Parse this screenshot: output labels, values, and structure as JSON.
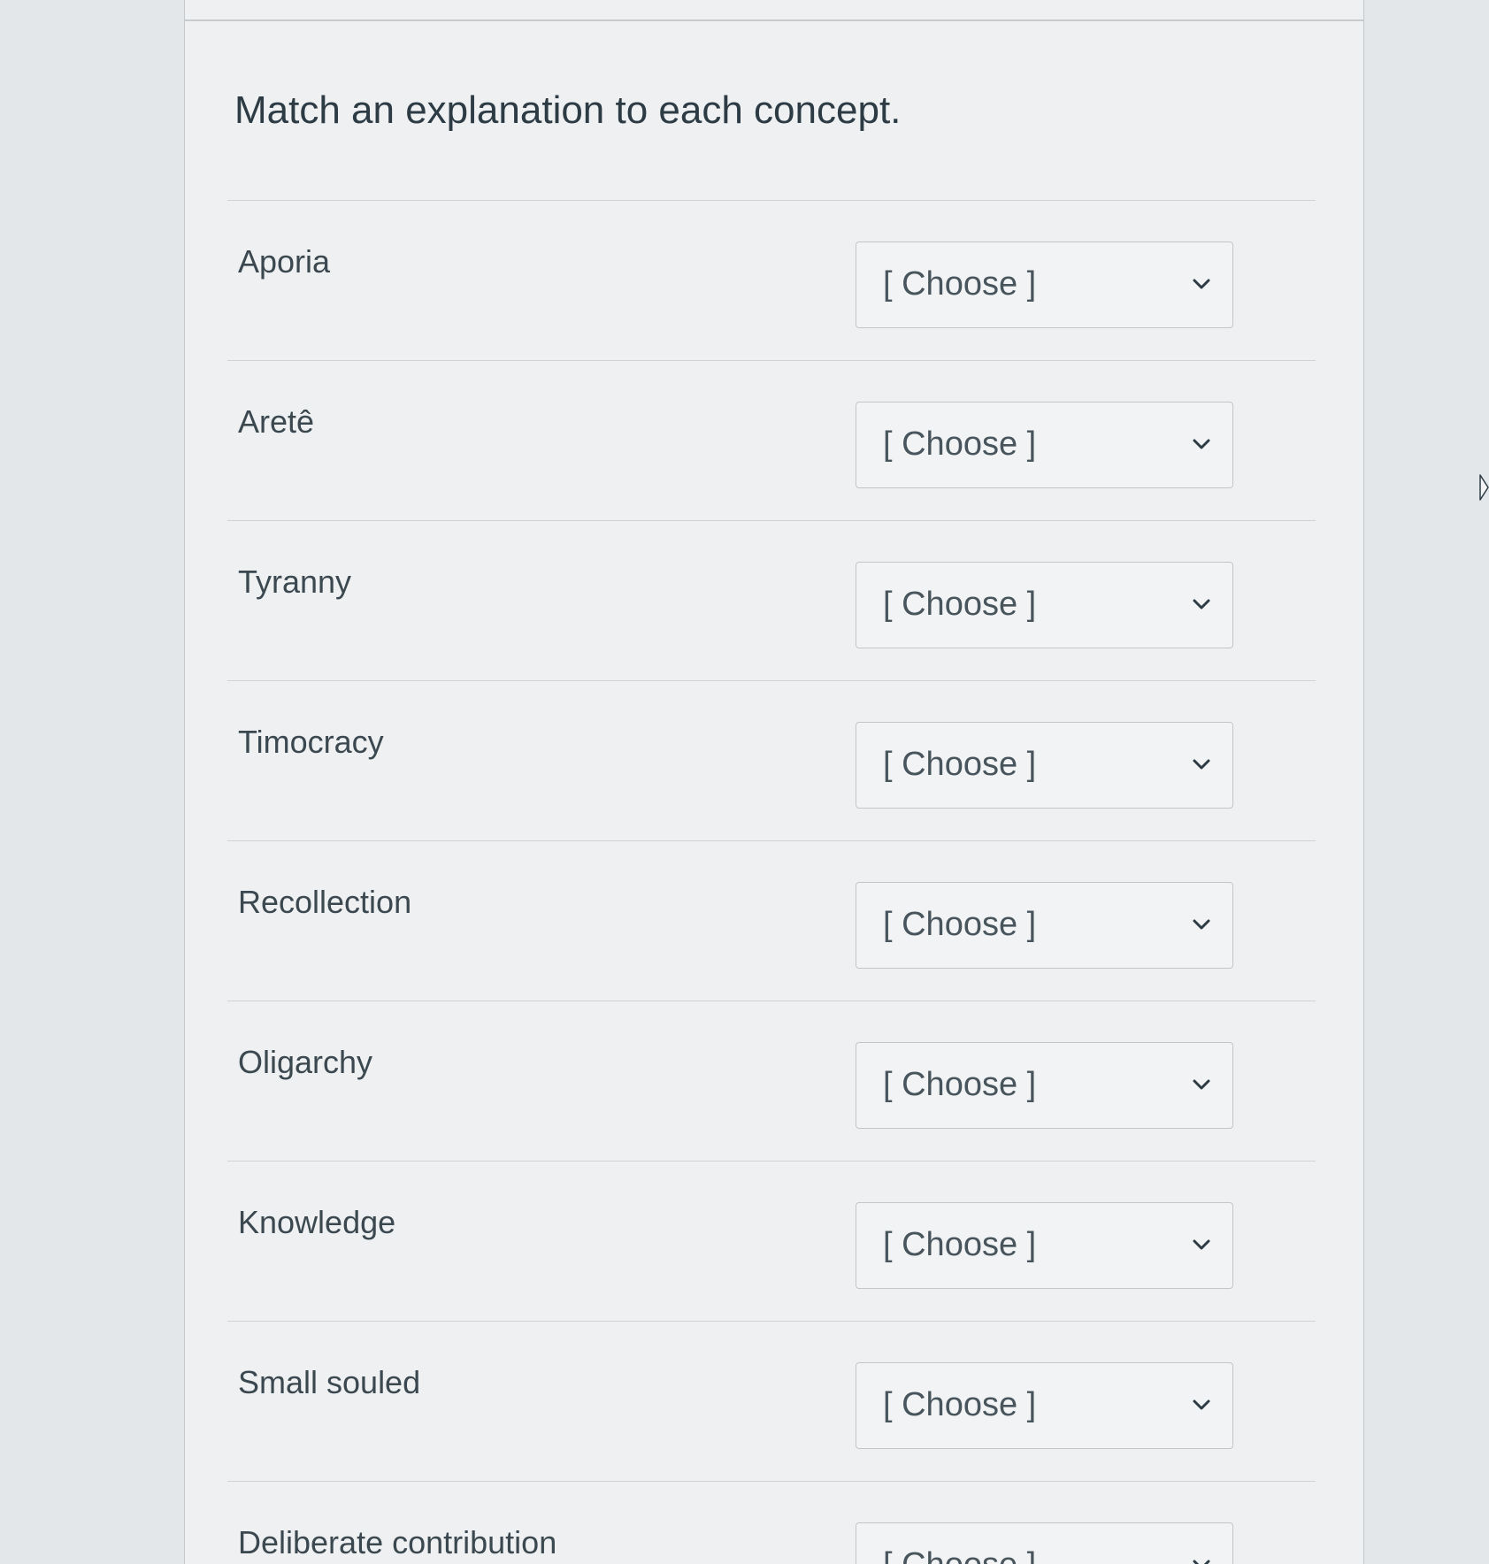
{
  "question": {
    "text": "Match an explanation to each concept."
  },
  "matches": [
    {
      "concept": "Aporia",
      "selected": "[ Choose ]"
    },
    {
      "concept": "Aretê",
      "selected": "[ Choose ]"
    },
    {
      "concept": "Tyranny",
      "selected": "[ Choose ]"
    },
    {
      "concept": "Timocracy",
      "selected": "[ Choose ]"
    },
    {
      "concept": "Recollection",
      "selected": "[ Choose ]"
    },
    {
      "concept": "Oligarchy",
      "selected": "[ Choose ]"
    },
    {
      "concept": "Knowledge",
      "selected": "[ Choose ]"
    },
    {
      "concept": "Small souled",
      "selected": "[ Choose ]"
    },
    {
      "concept": "Deliberate contribution",
      "selected": "[ Choose ]"
    }
  ],
  "icons": {
    "dropdown": "chevron-down-icon",
    "pointer": "cursor-icon"
  }
}
